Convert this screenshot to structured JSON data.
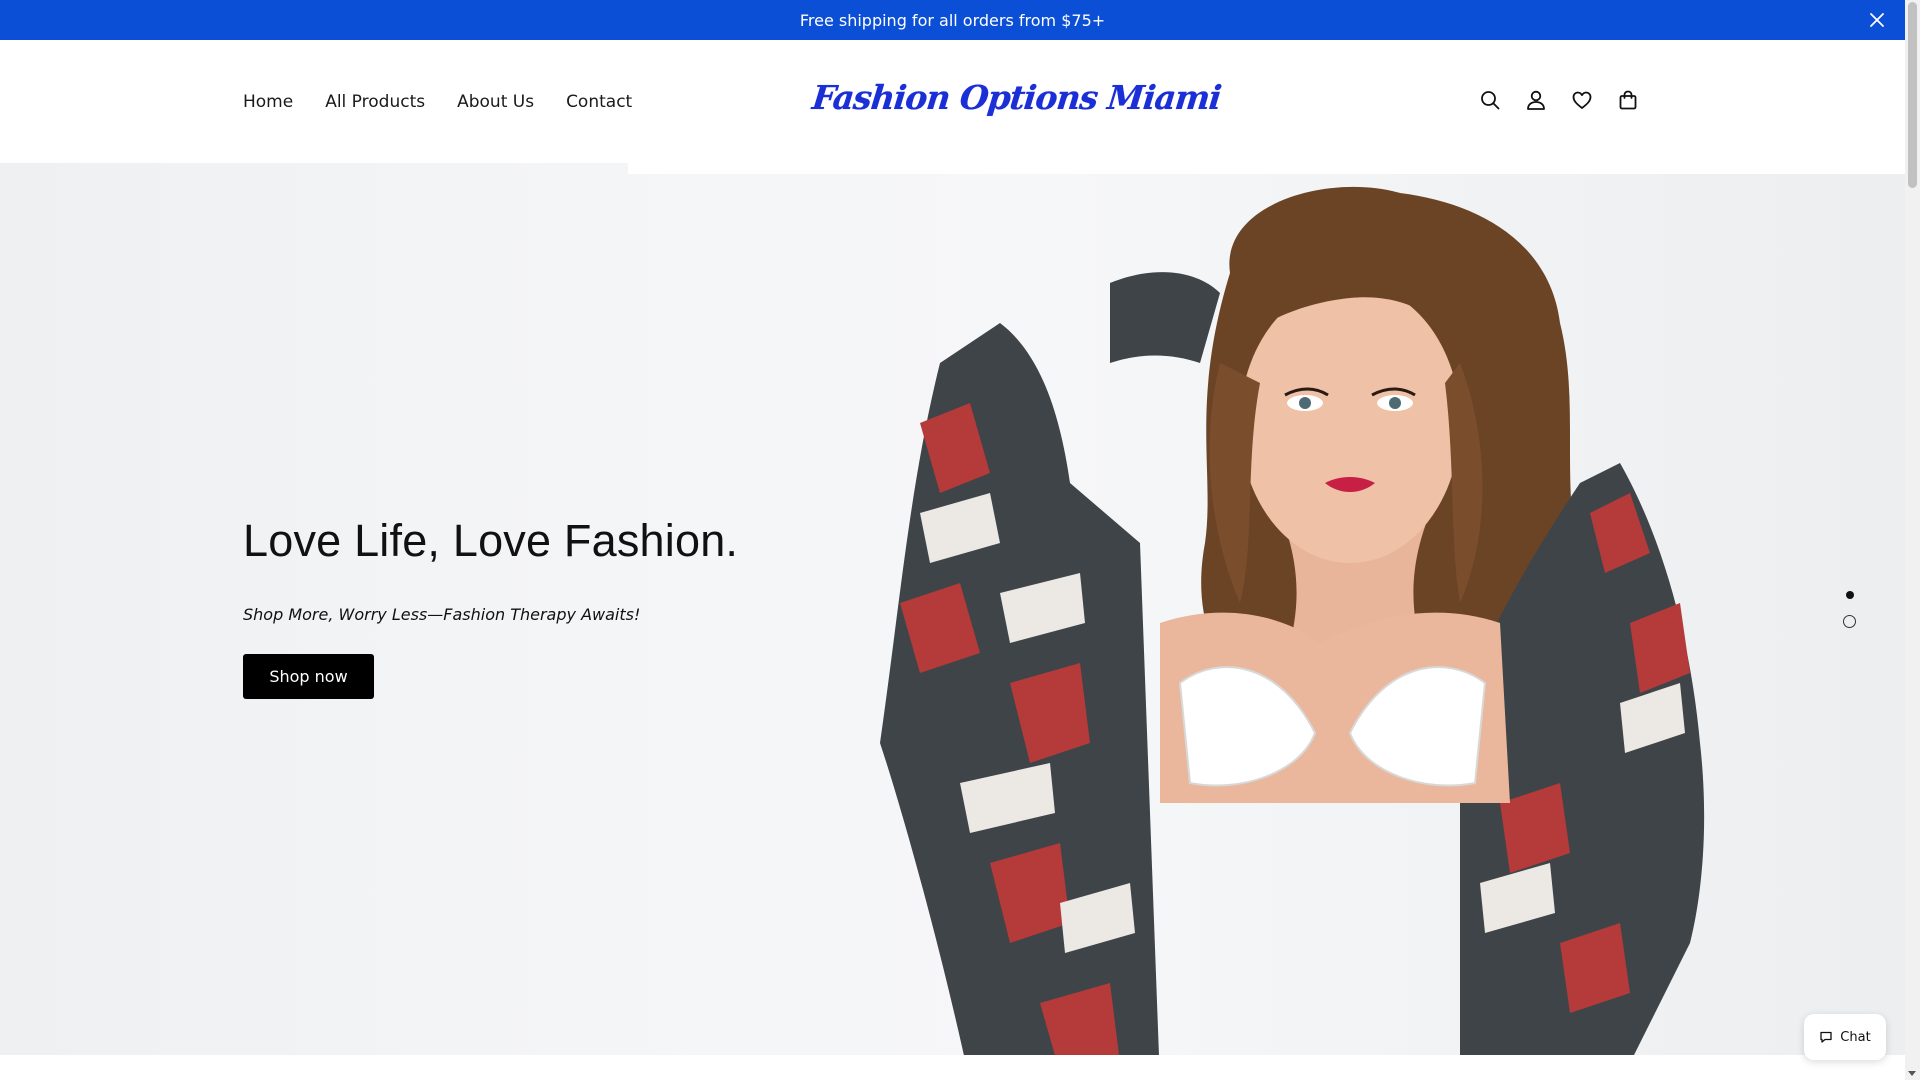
{
  "announcement": {
    "text": "Free shipping for all orders from $75+",
    "close_icon": "close-icon"
  },
  "nav": {
    "items": [
      {
        "label": "Home"
      },
      {
        "label": "All Products"
      },
      {
        "label": "About Us"
      },
      {
        "label": "Contact"
      }
    ]
  },
  "brand": {
    "logo_text": "Fashion Options Miami",
    "color": "#1b2fd6"
  },
  "header_icons": [
    "search-icon",
    "account-icon",
    "wishlist-heart-icon",
    "cart-bag-icon"
  ],
  "hero": {
    "title": "Love Life, Love Fashion.",
    "subtitle": "Shop More, Worry Less—Fashion Therapy Awaits!",
    "cta_label": "Shop now",
    "slide_count": 2,
    "active_slide": 1
  },
  "chat": {
    "label": "Chat",
    "icon": "chat-bubble-icon"
  },
  "colors": {
    "announcement_bg": "#0b4fd6",
    "cta_bg": "#000000"
  }
}
